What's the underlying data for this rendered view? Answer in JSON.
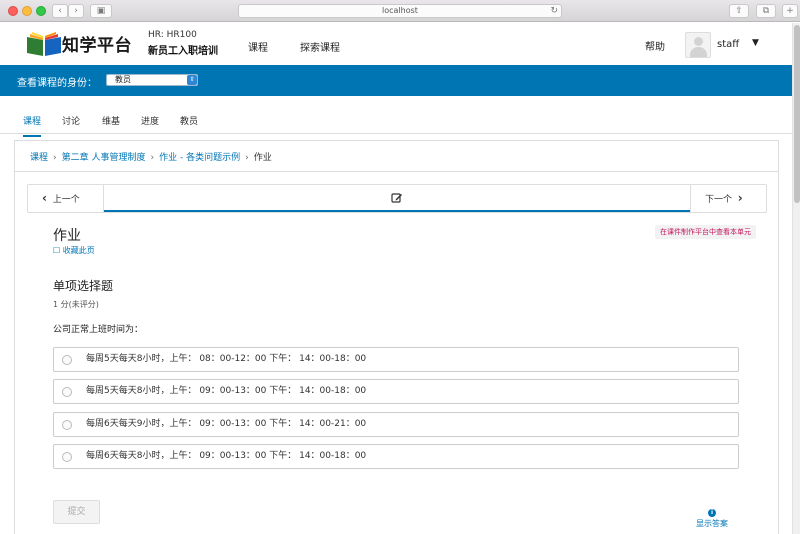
{
  "browser": {
    "url": "localhost"
  },
  "header": {
    "logo_text": "知学平台",
    "course_code": "HR: HR100",
    "course_name": "新员工入职培训",
    "nav": [
      "课程",
      "探索课程"
    ],
    "help": "帮助",
    "username": "staff"
  },
  "rolebar": {
    "label": "查看课程的身份：",
    "selected_role": "教员"
  },
  "tabs": [
    "课程",
    "讨论",
    "维基",
    "进度",
    "教员"
  ],
  "breadcrumb": {
    "items": [
      "课程",
      "第二章 人事管理制度",
      "作业 - 各类问题示例"
    ],
    "current": "作业"
  },
  "sequence": {
    "prev": "上一个",
    "next": "下一个"
  },
  "unit": {
    "title": "作业",
    "bookmark": "收藏此页",
    "studio_link": "在课件制作平台中查看本单元"
  },
  "problem": {
    "title": "单项选择题",
    "points": "1 分(未评分)",
    "prompt": "公司正常上班时间为：",
    "options": [
      "每周5天每天8小时，上午： 08：00-12：00 下午： 14：00-18：00",
      "每周5天每天8小时，上午： 09：00-13：00 下午： 14：00-18：00",
      "每周6天每天9小时，上午： 09：00-13：00 下午： 14：00-21：00",
      "每周6天每天8小时，上午： 09：00-13：00 下午： 14：00-18：00"
    ],
    "submit": "提交",
    "show_answer": "显示答案"
  },
  "colors": {
    "accent": "#0075b4",
    "studio_link": "#c2185b"
  }
}
